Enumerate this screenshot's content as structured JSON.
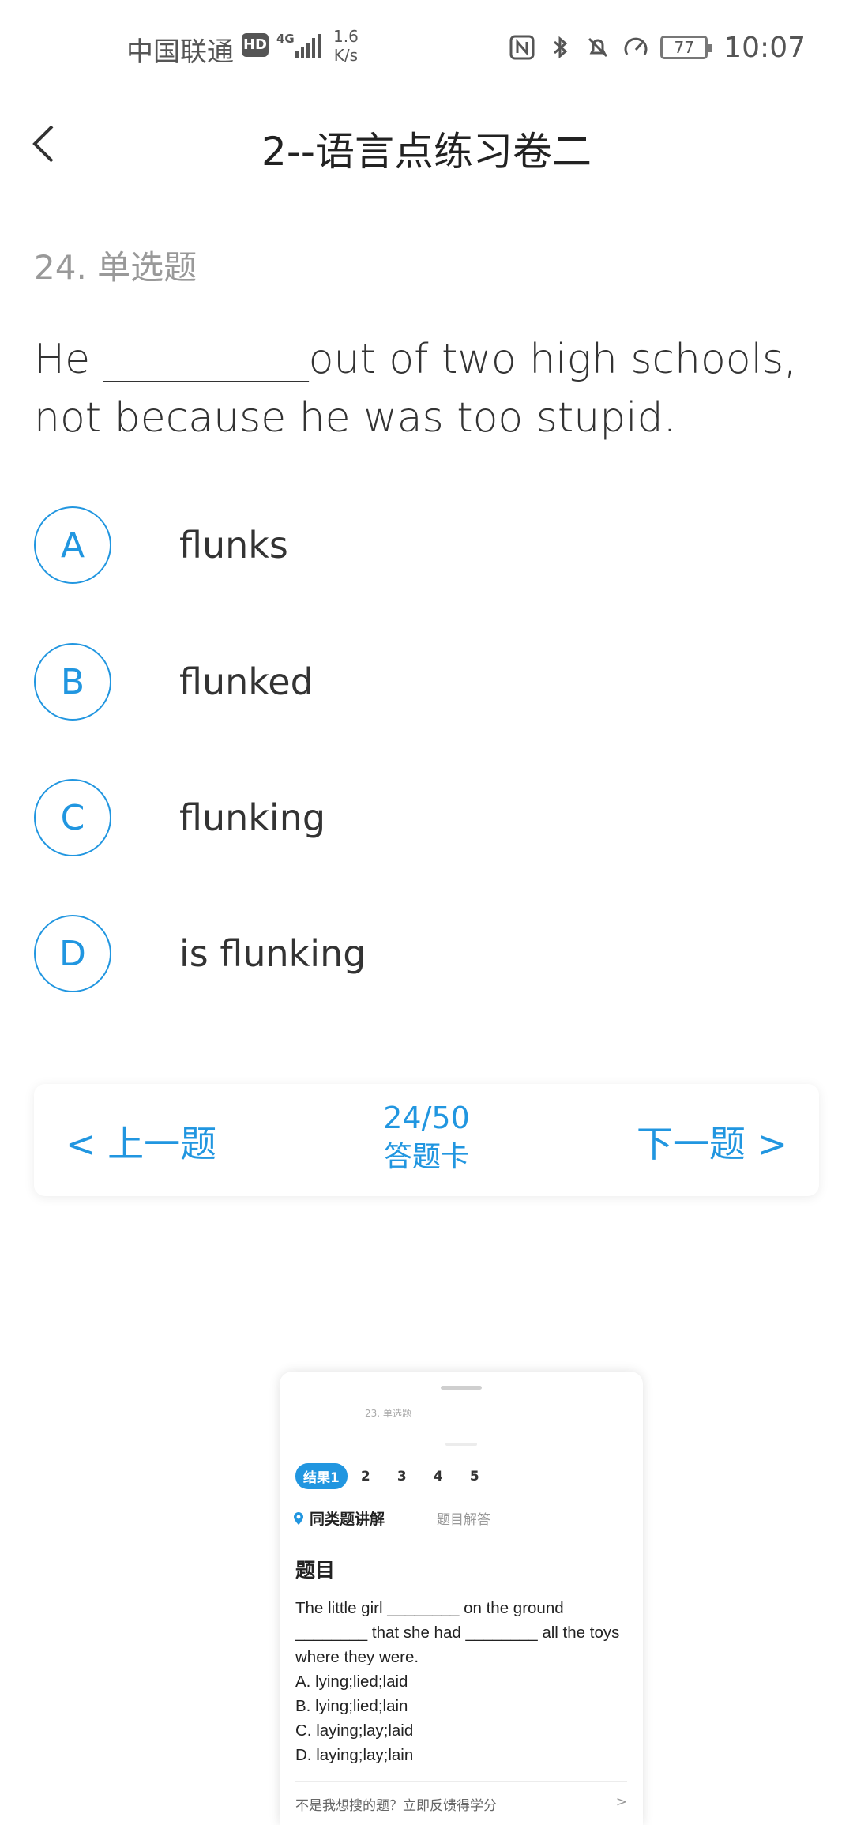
{
  "status_bar": {
    "carrier": "中国联通",
    "hd": "HD",
    "network": "4G",
    "speed_value": "1.6",
    "speed_unit": "K/s",
    "battery": "77",
    "time": "10:07"
  },
  "header": {
    "title": "2--语言点练习卷二"
  },
  "question": {
    "label": "24. 单选题",
    "text": "He __________out of two high schools, not because he was too stupid.",
    "options": [
      {
        "letter": "A",
        "text": "flunks"
      },
      {
        "letter": "B",
        "text": "flunked"
      },
      {
        "letter": "C",
        "text": "flunking"
      },
      {
        "letter": "D",
        "text": "is flunking"
      }
    ]
  },
  "nav": {
    "prev": "< 上一题",
    "counter": "24/50",
    "card": "答题卡",
    "next": "下一题 >"
  },
  "popup": {
    "mini_label": "23. 单选题",
    "tabs": [
      "结果1",
      "2",
      "3",
      "4",
      "5"
    ],
    "section_active": "同类题讲解",
    "section_inactive": "题目解答",
    "heading": "题目",
    "body_lines": [
      "The little girl ________ on the ground",
      "________ that she had ________ all the toys",
      "where they were.",
      "A. lying;lied;laid",
      "B. lying;lied;lain",
      "C. laying;lay;laid",
      "D. laying;lay;lain"
    ],
    "footer": "不是我想搜的题？立即反馈得学分",
    "footer_chevron": ">"
  },
  "colors": {
    "accent": "#2196e0",
    "text": "#333333",
    "muted": "#999999"
  }
}
